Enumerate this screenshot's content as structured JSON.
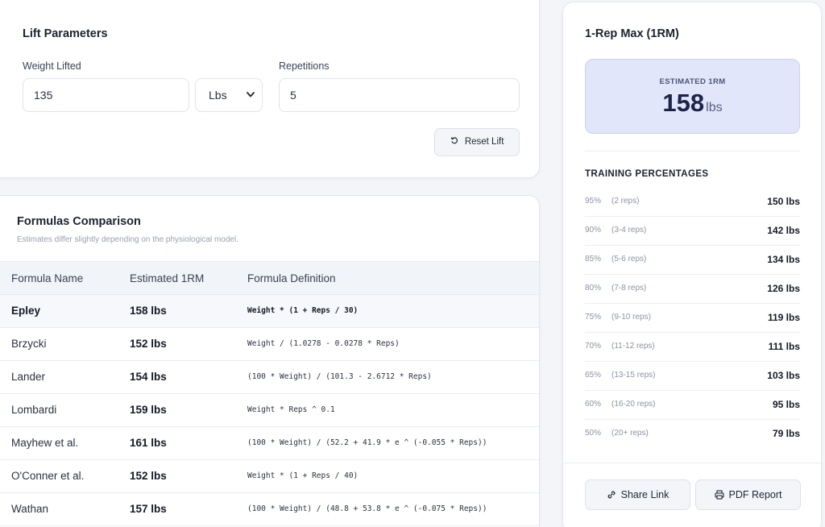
{
  "lift_parameters": {
    "title": "Lift Parameters",
    "weight_label": "Weight Lifted",
    "weight_value": "135",
    "unit_value": "Lbs",
    "reps_label": "Repetitions",
    "reps_value": "5",
    "reset_label": "Reset Lift"
  },
  "formulas": {
    "title": "Formulas Comparison",
    "subtitle": "Estimates differ slightly depending on the physiological model.",
    "headers": [
      "Formula Name",
      "Estimated 1RM",
      "Formula Definition"
    ],
    "rows": [
      {
        "name": "Epley",
        "value": "158 lbs",
        "definition": "Weight * (1 + Reps / 30)"
      },
      {
        "name": "Brzycki",
        "value": "152 lbs",
        "definition": "Weight / (1.0278 - 0.0278 * Reps)"
      },
      {
        "name": "Lander",
        "value": "154 lbs",
        "definition": "(100 * Weight) / (101.3 - 2.6712 * Reps)"
      },
      {
        "name": "Lombardi",
        "value": "159 lbs",
        "definition": "Weight * Reps ^ 0.1"
      },
      {
        "name": "Mayhew et al.",
        "value": "161 lbs",
        "definition": "(100 * Weight) / (52.2 + 41.9 * e ^ (-0.055 * Reps))"
      },
      {
        "name": "O'Conner et al.",
        "value": "152 lbs",
        "definition": "Weight * (1 + Reps / 40)"
      },
      {
        "name": "Wathan",
        "value": "157 lbs",
        "definition": "(100 * Weight) / (48.8 + 53.8 * e ^ (-0.075 * Reps))"
      }
    ]
  },
  "one_rep_max": {
    "title": "1-Rep Max (1RM)",
    "estimated_label": "ESTIMATED 1RM",
    "estimated_value": "158",
    "estimated_unit": "lbs",
    "training_title": "TRAINING PERCENTAGES",
    "percentages": [
      {
        "pct": "95%",
        "reps": "(2 reps)",
        "value": "150 lbs"
      },
      {
        "pct": "90%",
        "reps": "(3-4 reps)",
        "value": "142 lbs"
      },
      {
        "pct": "85%",
        "reps": "(5-6 reps)",
        "value": "134 lbs"
      },
      {
        "pct": "80%",
        "reps": "(7-8 reps)",
        "value": "126 lbs"
      },
      {
        "pct": "75%",
        "reps": "(9-10 reps)",
        "value": "119 lbs"
      },
      {
        "pct": "70%",
        "reps": "(11-12 reps)",
        "value": "111 lbs"
      },
      {
        "pct": "65%",
        "reps": "(13-15 reps)",
        "value": "103 lbs"
      },
      {
        "pct": "60%",
        "reps": "(16-20 reps)",
        "value": "95 lbs"
      },
      {
        "pct": "50%",
        "reps": "(20+ reps)",
        "value": "79 lbs"
      }
    ],
    "share_label": "Share Link",
    "pdf_label": "PDF Report"
  },
  "icons": {
    "reset": "rotate-ccw-icon",
    "select": "chevron-down-icon",
    "share": "link-icon",
    "pdf": "printer-icon"
  },
  "colors": {
    "background": "#f3f5f9",
    "accent_box": "#e2e6fb",
    "accent_text": "#1c2547"
  }
}
